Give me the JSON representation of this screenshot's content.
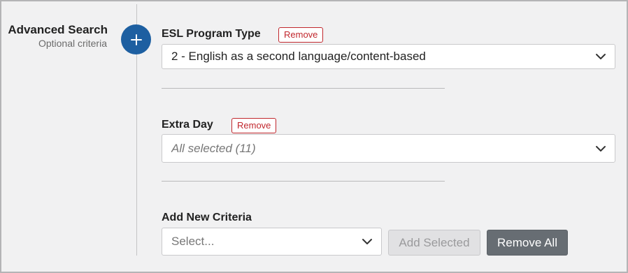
{
  "sidebar": {
    "title": "Advanced Search",
    "subtitle": "Optional criteria"
  },
  "criteria": [
    {
      "label": "ESL Program Type",
      "remove_label": "Remove",
      "value": "2 - English as a second language/content-based"
    },
    {
      "label": "Extra Day",
      "remove_label": "Remove",
      "value": "All selected (11)"
    }
  ],
  "add_new": {
    "label": "Add New Criteria",
    "placeholder": "Select...",
    "add_selected_label": "Add Selected",
    "remove_all_label": "Remove All"
  },
  "icons": {
    "add": "plus-icon",
    "dropdown": "chevron-down-icon"
  },
  "colors": {
    "accent": "#1d5fa1",
    "remove": "#c1272d",
    "dark_button": "#676d73"
  }
}
